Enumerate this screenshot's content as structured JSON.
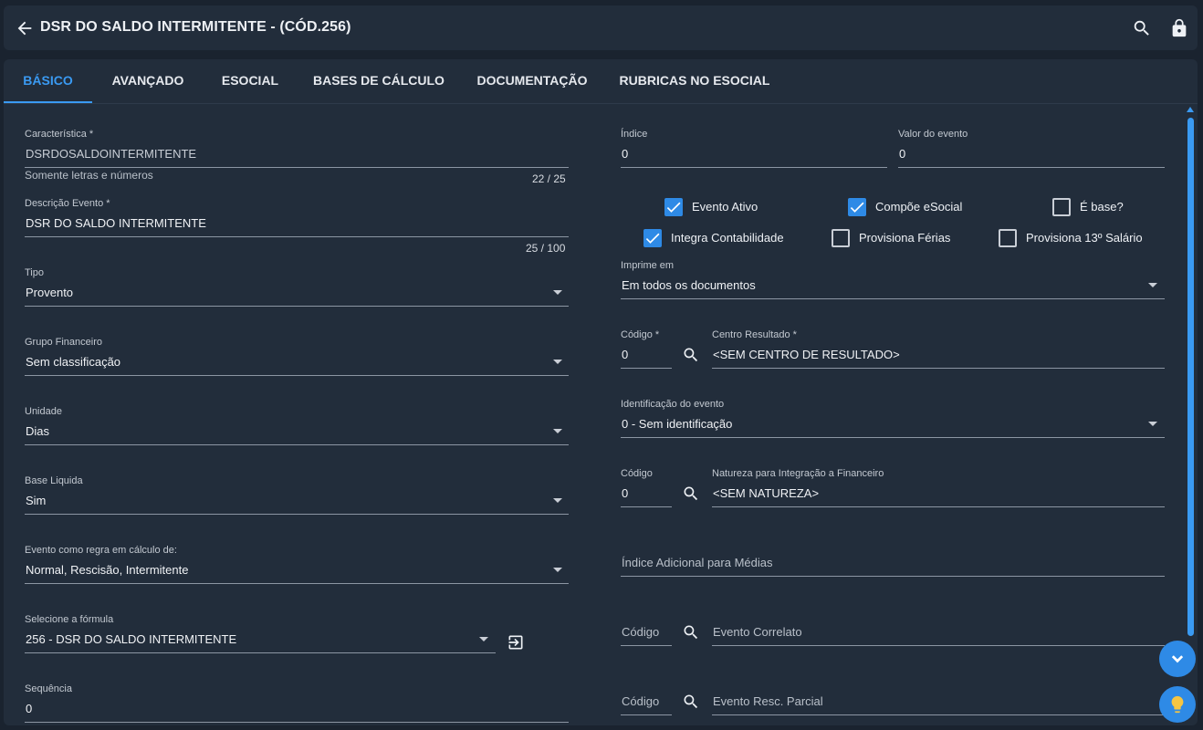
{
  "header": {
    "title": "DSR DO SALDO INTERMITENTE - (CÓD.256)"
  },
  "tabs": [
    {
      "label": "BÁSICO",
      "active": true
    },
    {
      "label": "AVANÇADO",
      "active": false
    },
    {
      "label": "ESOCIAL",
      "active": false
    },
    {
      "label": "BASES DE CÁLCULO",
      "active": false
    },
    {
      "label": "DOCUMENTAÇÃO",
      "active": false
    },
    {
      "label": "RUBRICAS NO ESOCIAL",
      "active": false
    }
  ],
  "left": {
    "caracteristica": {
      "label": "Característica *",
      "value": "DSRDOSALDOINTERMITENTE",
      "hint": "Somente letras e números",
      "counter": "22 / 25"
    },
    "descricao": {
      "label": "Descrição Evento *",
      "value": "DSR DO SALDO INTERMITENTE",
      "counter": "25 / 100"
    },
    "tipo": {
      "label": "Tipo",
      "value": "Provento"
    },
    "grupo": {
      "label": "Grupo Financeiro",
      "value": "Sem classificação"
    },
    "unidade": {
      "label": "Unidade",
      "value": "Dias"
    },
    "base_liquida": {
      "label": "Base Liquida",
      "value": "Sim"
    },
    "regra": {
      "label": "Evento como regra em cálculo de:",
      "value": "Normal, Rescisão, Intermitente"
    },
    "formula": {
      "label": "Selecione a fórmula",
      "value": "256 - DSR DO SALDO INTERMITENTE"
    },
    "sequencia": {
      "label": "Sequência",
      "value": "0"
    }
  },
  "right": {
    "indice": {
      "label": "Índice",
      "value": "0"
    },
    "valor": {
      "label": "Valor do evento",
      "value": "0"
    },
    "checkboxes": {
      "evento_ativo": {
        "label": "Evento Ativo",
        "checked": true
      },
      "compoe_esocial": {
        "label": "Compõe eSocial",
        "checked": true
      },
      "e_base": {
        "label": "É base?",
        "checked": false
      },
      "integra_contab": {
        "label": "Integra Contabilidade",
        "checked": true
      },
      "provisiona_ferias": {
        "label": "Provisiona Férias",
        "checked": false
      },
      "provisiona_13": {
        "label": "Provisiona 13º Salário",
        "checked": false
      }
    },
    "imprime": {
      "label": "Imprime em",
      "value": "Em todos os documentos"
    },
    "codigo_cr": {
      "label": "Código *",
      "value": "0"
    },
    "centro_resultado": {
      "label": "Centro Resultado *",
      "value": "<SEM CENTRO DE RESULTADO>"
    },
    "identificacao": {
      "label": "Identificação do evento",
      "value": "0 - Sem identificação"
    },
    "codigo_nat": {
      "label": "Código",
      "value": "0"
    },
    "natureza": {
      "label": "Natureza para Integração a Financeiro",
      "value": "<SEM NATUREZA>"
    },
    "indice_adicional": {
      "placeholder": "Índice Adicional para Médias"
    },
    "codigo_correlato": {
      "placeholder": "Código"
    },
    "evento_correlato": {
      "placeholder": "Evento Correlato"
    },
    "codigo_resc": {
      "placeholder": "Código"
    },
    "evento_resc": {
      "placeholder": "Evento Resc. Parcial"
    }
  },
  "colors": {
    "accent": "#3a9af2",
    "background": "#1a232f",
    "surface": "#222d3b",
    "checkbox_on": "#2e8ae6"
  },
  "icons": [
    "arrow-left-icon",
    "search-icon",
    "lock-icon",
    "exit-to-app-icon",
    "chevron-down-icon",
    "lightbulb-icon"
  ]
}
